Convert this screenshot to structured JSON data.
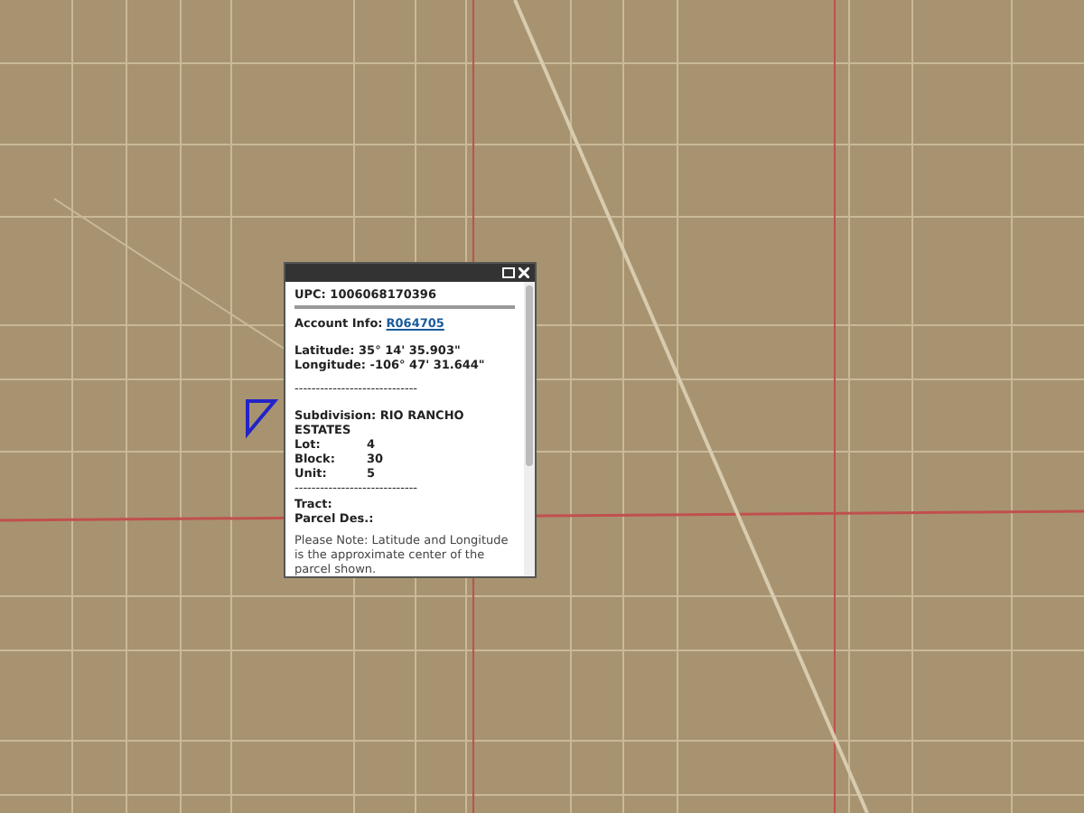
{
  "popup": {
    "title": "UPC: 1006068170396",
    "account": {
      "label": "Account Info:",
      "link": "R064705"
    },
    "latitude": "Latitude: 35° 14' 35.903\"",
    "longitude": "Longitude: -106° 47' 31.644\"",
    "separator_1": "-----------------------------",
    "subdivision": "Subdivision: RIO RANCHO ESTATES",
    "fields": [
      {
        "label": "Lot:",
        "value": "4"
      },
      {
        "label": "Block:",
        "value": "30"
      },
      {
        "label": "Unit:",
        "value": "5"
      }
    ],
    "separator_2": "-----------------------------",
    "tract": "Tract:",
    "parcel": "Parcel Des.:",
    "note": "Please Note: Latitude and Longitude is the approximate center of the parcel shown."
  }
}
